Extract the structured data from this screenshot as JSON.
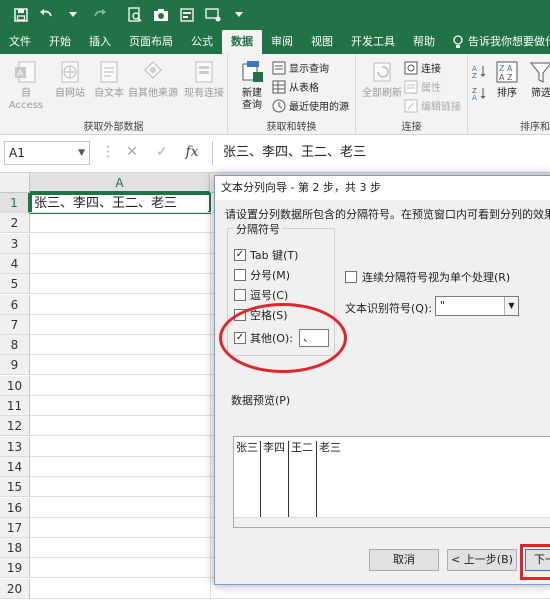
{
  "ribbon_tabs": [
    "文件",
    "开始",
    "插入",
    "页面布局",
    "公式",
    "数据",
    "审阅",
    "视图",
    "开发工具",
    "帮助"
  ],
  "active_tab": "数据",
  "tell_me": "告诉我你想要做什",
  "groups": {
    "external": {
      "label": "获取外部数据",
      "buttons": [
        "自 Access",
        "自网站",
        "自文本",
        "自其他来源",
        "现有连接"
      ]
    },
    "transform": {
      "label": "获取和转换",
      "new_query": "新建\n查询",
      "show_query": "显示查询",
      "from_table": "从表格",
      "recent_sources": "最近使用的源"
    },
    "connections": {
      "label": "连接",
      "refresh_all": "全部刷新",
      "connect": "连接",
      "properties": "属性",
      "edit_links": "编辑链接"
    },
    "sort": {
      "label": "排序和",
      "sort": "排序",
      "filter": "筛选"
    }
  },
  "name_box": "A1",
  "formula": "张三、李四、王二、老三",
  "column_header": "A",
  "rows": [
    "1",
    "2",
    "3",
    "4",
    "5",
    "6",
    "7",
    "8",
    "9",
    "10",
    "11",
    "12",
    "13",
    "14",
    "15",
    "16",
    "17",
    "18",
    "19",
    "20"
  ],
  "cell_a1": "张三、李四、王二、老三",
  "dialog": {
    "title": "文本分列向导 - 第 2 步，共 3 步",
    "description": "请设置分列数据所包含的分隔符号。在预览窗口内可看到分列的效果。",
    "separator_title": "分隔符号",
    "options": [
      {
        "label": "Tab 键(T)",
        "checked": true
      },
      {
        "label": "分号(M)",
        "checked": false
      },
      {
        "label": "逗号(C)",
        "checked": false
      },
      {
        "label": "空格(S)",
        "checked": false
      },
      {
        "label": "其他(O):",
        "checked": true
      }
    ],
    "other_value": "、",
    "consecutive": "连续分隔符号视为单个处理(R)",
    "qualifier_label": "文本识别符号(Q):",
    "qualifier_value": "\"",
    "preview_label": "数据预览(P)",
    "preview_columns": [
      "张三",
      "李四",
      "王二",
      "老三"
    ],
    "buttons": {
      "cancel": "取消",
      "back": "< 上一步(B)",
      "next": "下一"
    }
  },
  "colors": {
    "excel_green": "#217346",
    "annotation_red": "#e0262b"
  }
}
